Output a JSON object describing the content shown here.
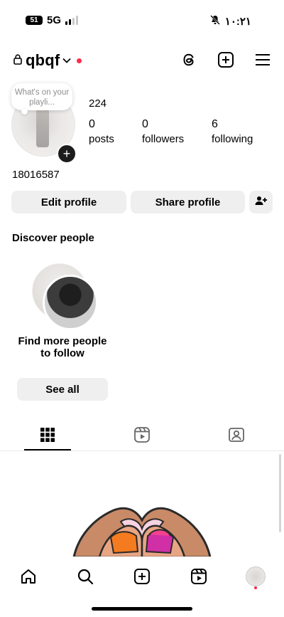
{
  "status_bar": {
    "battery": "51",
    "network": "5G",
    "time": "١٠:٢١"
  },
  "header": {
    "username": "qbqf"
  },
  "profile": {
    "note_text": "What's on your playli...",
    "full_name": "224",
    "stats": [
      {
        "num": "0",
        "label": "posts"
      },
      {
        "num": "0",
        "label": "followers"
      },
      {
        "num": "6",
        "label": "following"
      }
    ],
    "bio": "18016587"
  },
  "actions": {
    "edit": "Edit profile",
    "share": "Share profile"
  },
  "discover": {
    "title": "Discover people",
    "card_text": "Find more people to follow",
    "see_all": "See all"
  },
  "colors": {
    "accent_dot": "#ff2b4a",
    "button_bg": "#efeff0"
  }
}
